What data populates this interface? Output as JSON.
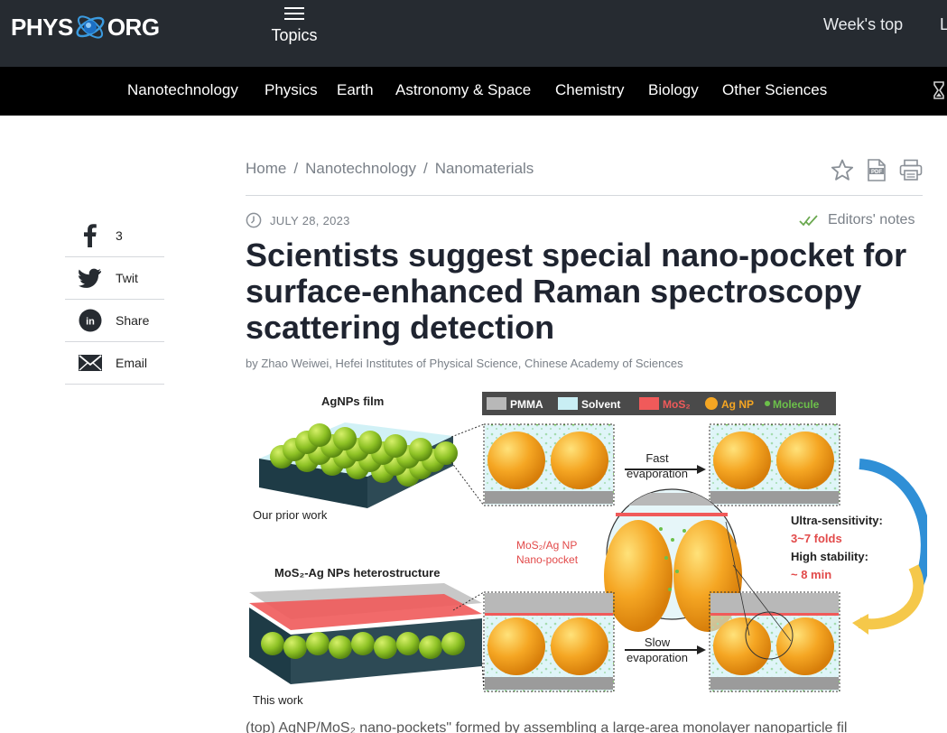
{
  "header": {
    "logo_left": "PHYS",
    "logo_right": "ORG",
    "topics_label": "Topics",
    "weeks_top_label": "Week's top",
    "cut_link_label": "L"
  },
  "nav": {
    "items": [
      "Nanotechnology",
      "Physics",
      "Earth",
      "Astronomy & Space",
      "Chemistry",
      "Biology",
      "Other Sciences"
    ]
  },
  "share": {
    "facebook_count": "3",
    "twitter_label": "Twit",
    "linkedin_label": "Share",
    "email_label": "Email"
  },
  "breadcrumb": {
    "items": [
      "Home",
      "Nanotechnology",
      "Nanomaterials"
    ],
    "separator": "/"
  },
  "article": {
    "date": "JULY 28, 2023",
    "editors_notes": "Editors' notes",
    "title": "Scientists suggest special nano-pocket for surface-enhanced Raman spectroscopy scattering detection",
    "byline": "by Zhao Weiwei, Hefei Institutes of Physical Science, Chinese Academy of Sciences",
    "caption_visible": "(top) AgNP/MoS₂ nano-pockets\" formed by assembling a large-area monolayer nanoparticle fil"
  },
  "figure": {
    "top_label": "AgNPs film",
    "prior_label": "Our prior work",
    "hetero_label": "MoS₂-Ag NPs heterostructure",
    "this_label": "This work",
    "legend": [
      "PMMA",
      "Solvent",
      "MoS₂",
      "Ag NP",
      "Molecule"
    ],
    "fast_line1": "Fast",
    "fast_line2": "evaporation",
    "slow_line1": "Slow",
    "slow_line2": "evaporation",
    "pocket_line1": "MoS₂/Ag NP",
    "pocket_line2": "Nano-pocket",
    "sens_title": "Ultra-sensitivity:",
    "sens_value": "3~7 folds",
    "stab_title": "High stability:",
    "stab_value": "~ 8 min",
    "colors": {
      "pmma": "#b8b8b8",
      "solvent": "#c9eef4",
      "mos2": "#f05a5a",
      "agnp": "#f5a623",
      "molecule": "#6cc04a",
      "arrow_blue": "#2f8fd6",
      "arrow_yellow": "#f5c84a"
    }
  }
}
